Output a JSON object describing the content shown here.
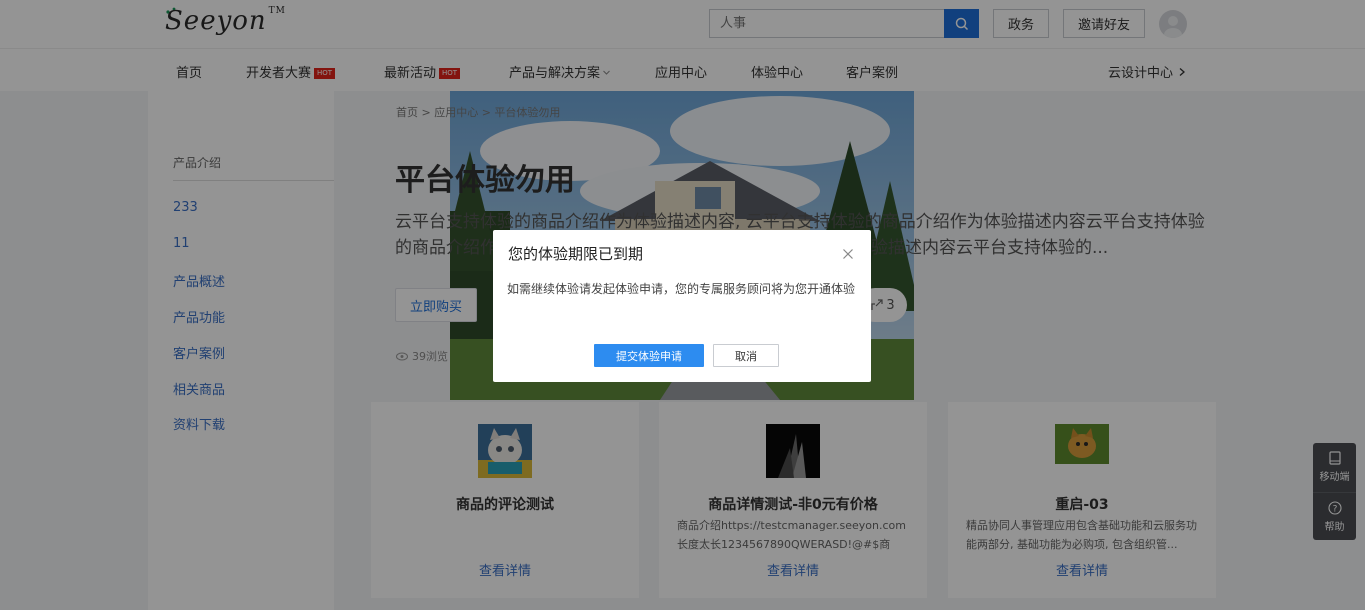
{
  "header": {
    "logo_text": "Seeyon",
    "logo_tm": "TM",
    "search": {
      "placeholder": "人事"
    },
    "btn_gov": "政务",
    "btn_invite": "邀请好友"
  },
  "nav": {
    "items": [
      {
        "label": "首页"
      },
      {
        "label": "开发者大赛",
        "badge": "HOT"
      },
      {
        "label": "最新活动",
        "badge": "HOT"
      },
      {
        "label": "产品与解决方案"
      },
      {
        "label": "应用中心"
      },
      {
        "label": "体验中心"
      },
      {
        "label": "客户案例"
      }
    ],
    "right_link": "云设计中心"
  },
  "sidebar": {
    "title": "产品介绍",
    "items": [
      "233",
      "11",
      "产品概述",
      "产品功能",
      "客户案例",
      "相关商品",
      "资料下载"
    ]
  },
  "main": {
    "breadcrumb": "首页 > 应用中心 > 平台体验勿用",
    "title": "平台体验勿用",
    "description": "云平台支持体验的商品介绍作为体验描述内容, 云平台支持体验的商品介绍作为体验描述内容云平台支持体验的商品介绍作为体验描述内容云平台支持体验的商品介绍作为体验描述内容云平台支持体验的...",
    "buy_button": "立即购买",
    "share_count": "3",
    "views": "39浏览"
  },
  "cards": [
    {
      "title": "商品的评论测试",
      "desc": "",
      "link": "查看详情"
    },
    {
      "title": "商品详情测试-非0元有价格",
      "desc": "商品介绍https://testcmanager.seeyon.com 长度太长1234567890QWERASD!@#$商品...",
      "link": "查看详情"
    },
    {
      "title": "重启-03",
      "desc": "精品协同人事管理应用包含基础功能和云服务功能两部分, 基础功能为必购项, 包含组织管...",
      "link": "查看详情"
    }
  ],
  "float_panel": {
    "mobile": "移动端",
    "help": "帮助"
  },
  "dialog": {
    "title": "您的体验期限已到期",
    "body": "如需继续体验请发起体验申请，您的专属服务顾问将为您开通体验",
    "confirm": "提交体验申请",
    "cancel": "取消"
  },
  "colors": {
    "primary": "#2d8cf0",
    "link": "#3a6fc4",
    "hot": "#e2231a",
    "search_btn": "#1e6fd9"
  }
}
